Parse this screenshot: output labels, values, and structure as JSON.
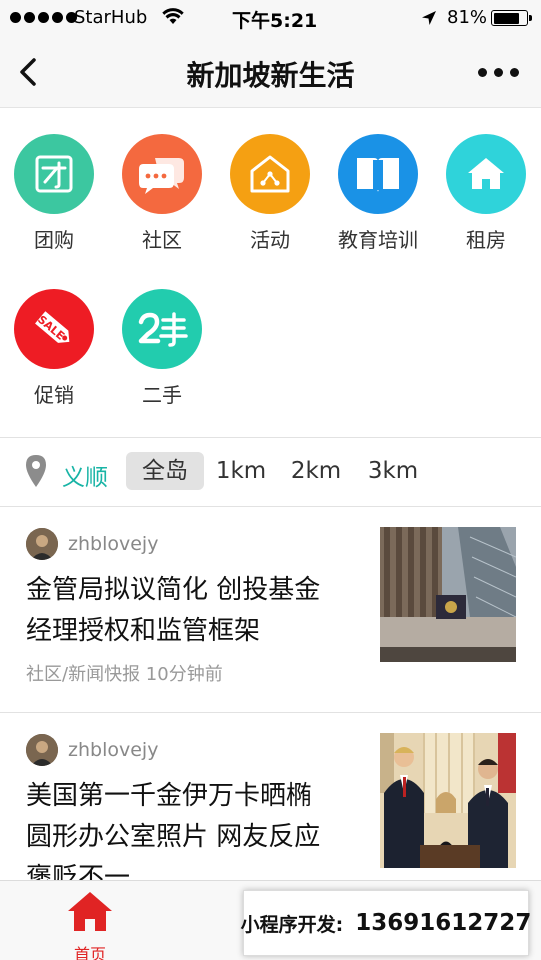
{
  "status_bar": {
    "carrier": "StarHub",
    "time": "下午5:21",
    "battery": "81%",
    "battery_level": 0.81
  },
  "nav": {
    "title": "新加坡新生活"
  },
  "categories": [
    {
      "label": "团购",
      "icon": "tuan-icon",
      "color": "#3cc7a0"
    },
    {
      "label": "社区",
      "icon": "chat-bubbles-icon",
      "color": "#f4693f"
    },
    {
      "label": "活动",
      "icon": "house-share-icon",
      "color": "#f5a012"
    },
    {
      "label": "教育培训",
      "icon": "book-icon",
      "color": "#1a92e6"
    },
    {
      "label": "租房",
      "icon": "home-icon",
      "color": "#2fd3da"
    },
    {
      "label": "促销",
      "icon": "sale-tag-icon",
      "color": "#ee1c24"
    },
    {
      "label": "二手",
      "icon": "second-hand-icon",
      "color": "#22ccae"
    }
  ],
  "filter": {
    "location": "义顺",
    "options": [
      "全岛",
      "1km",
      "2km",
      "3km"
    ],
    "selected": "全岛"
  },
  "news": [
    {
      "author": "zhblovejy",
      "title_line1": "金管局拟议简化 创投基金",
      "title_line2": "经理授权和监管框架",
      "meta": "社区/新闻快报   10分钟前"
    },
    {
      "author": "zhblovejy",
      "title_line1": "美国第一千金伊万卡晒椭",
      "title_line2": "圆形办公室照片 网友反应",
      "title_line3": "褒贬不一"
    }
  ],
  "tab_bar": {
    "home_label": "首页",
    "accent": "#e02424"
  },
  "promo": {
    "label": "小程序开发:",
    "phone": "13691612727"
  }
}
